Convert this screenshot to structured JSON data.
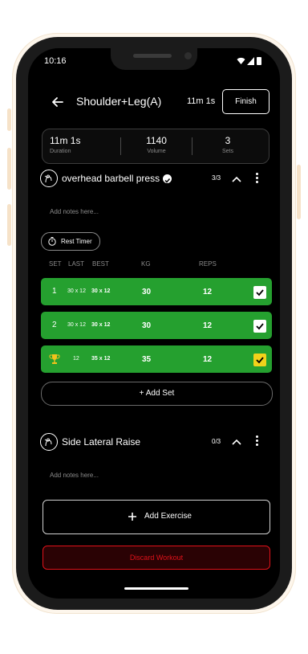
{
  "status_bar": {
    "time": "10:16"
  },
  "header": {
    "title": "Shoulder+Leg(A)",
    "elapsed": "11m 1s",
    "finish_label": "Finish"
  },
  "summary": [
    {
      "value": "11m 1s",
      "label": "Duration"
    },
    {
      "value": "1140",
      "label": "Volume"
    },
    {
      "value": "3",
      "label": "Sets"
    }
  ],
  "exercise1": {
    "name": "overhead barbell press",
    "progress": "3/3",
    "notes_placeholder": "Add notes here...",
    "rest_timer_label": "Rest Timer",
    "columns": {
      "set": "SET",
      "last": "LAST",
      "best": "BEST",
      "kg": "KG",
      "reps": "REPS"
    },
    "sets": [
      {
        "set": "1",
        "last": "30 x 12",
        "best": "30 x 12",
        "kg": "30",
        "reps": "12"
      },
      {
        "set": "2",
        "last": "30 x 12",
        "best": "30 x 12",
        "kg": "30",
        "reps": "12"
      },
      {
        "set": "",
        "last": "12",
        "best": "35 x 12",
        "kg": "35",
        "reps": "12"
      }
    ],
    "add_set_label": "+ Add Set"
  },
  "exercise2": {
    "name": "Side Lateral Raise",
    "progress": "0/3",
    "notes_placeholder": "Add notes here..."
  },
  "add_exercise_label": "Add Exercise",
  "discard_label": "Discard Workout",
  "colors": {
    "accent_green": "#25a02f",
    "danger": "#e0121a",
    "check_yellow": "#f2d21b",
    "background": "#000000"
  }
}
